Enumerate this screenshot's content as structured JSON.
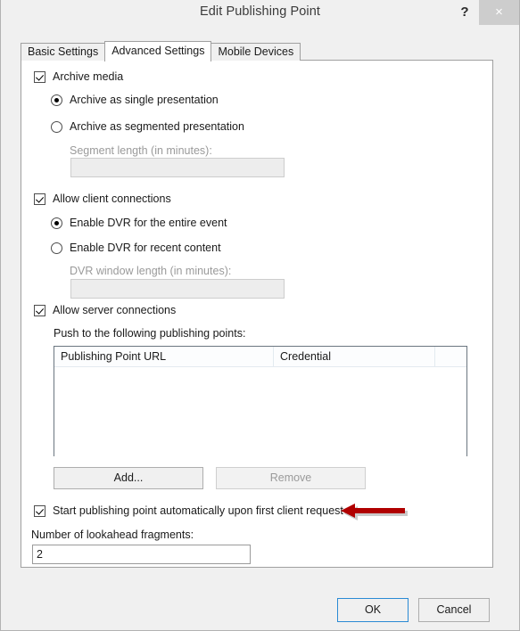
{
  "window": {
    "title": "Edit Publishing Point",
    "help_label": "?",
    "close_label": "×"
  },
  "tabs": [
    {
      "label": "Basic Settings",
      "active": false
    },
    {
      "label": "Advanced Settings",
      "active": true
    },
    {
      "label": "Mobile Devices",
      "active": false
    }
  ],
  "archive": {
    "checkbox_label": "Archive media",
    "checked": true,
    "radio_single_label": "Archive as single presentation",
    "radio_segmented_label": "Archive as segmented presentation",
    "selected": "single",
    "segment_length_label": "Segment length (in minutes):",
    "segment_length_value": "",
    "segment_length_enabled": false
  },
  "client": {
    "checkbox_label": "Allow client connections",
    "checked": true,
    "radio_entire_label": "Enable DVR for the entire event",
    "radio_recent_label": "Enable DVR for recent content",
    "selected": "entire",
    "dvr_window_label": "DVR window length (in minutes):",
    "dvr_window_value": "",
    "dvr_window_enabled": false
  },
  "server": {
    "checkbox_label": "Allow server connections",
    "checked": true,
    "push_label": "Push to the following publishing points:",
    "table": {
      "columns": [
        "Publishing Point URL",
        "Credential",
        ""
      ],
      "rows": []
    },
    "add_label": "Add...",
    "add_enabled": true,
    "remove_label": "Remove",
    "remove_enabled": false
  },
  "startup": {
    "checkbox_label": "Start publishing point automatically upon first client request",
    "checked": true,
    "lookahead_label": "Number of lookahead fragments:",
    "lookahead_value": "2"
  },
  "footer": {
    "ok_label": "OK",
    "cancel_label": "Cancel"
  },
  "annotation": {
    "arrow_color": "#b00000",
    "direction": "left"
  }
}
